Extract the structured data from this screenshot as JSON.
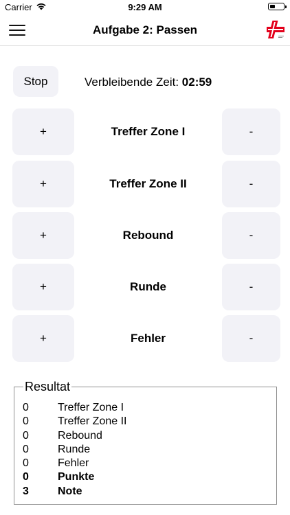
{
  "status_bar": {
    "carrier": "Carrier",
    "time": "9:29 AM"
  },
  "nav": {
    "title": "Aufgabe 2: Passen",
    "menu_icon": "hamburger-menu-icon",
    "logo_icon": "red-cross-logo-icon",
    "logo_color": "#e3001b"
  },
  "timer": {
    "stop_label": "Stop",
    "remaining_label": "Verbleibende Zeit:",
    "remaining_value": "02:59"
  },
  "counters": [
    {
      "label": "Treffer Zone I",
      "plus": "+",
      "minus": "-"
    },
    {
      "label": "Treffer Zone II",
      "plus": "+",
      "minus": "-"
    },
    {
      "label": "Rebound",
      "plus": "+",
      "minus": "-"
    },
    {
      "label": "Runde",
      "plus": "+",
      "minus": "-"
    },
    {
      "label": "Fehler",
      "plus": "+",
      "minus": "-"
    }
  ],
  "result": {
    "title": "Resultat",
    "rows": [
      {
        "value": "0",
        "label": "Treffer Zone I"
      },
      {
        "value": "0",
        "label": "Treffer Zone II"
      },
      {
        "value": "0",
        "label": "Rebound"
      },
      {
        "value": "0",
        "label": "Runde"
      },
      {
        "value": "0",
        "label": "Fehler"
      },
      {
        "value": "0",
        "label": "Punkte"
      },
      {
        "value": "3",
        "label": "Note"
      }
    ]
  },
  "colors": {
    "button_bg": "#f2f2f7",
    "brand_red": "#e3001b"
  }
}
